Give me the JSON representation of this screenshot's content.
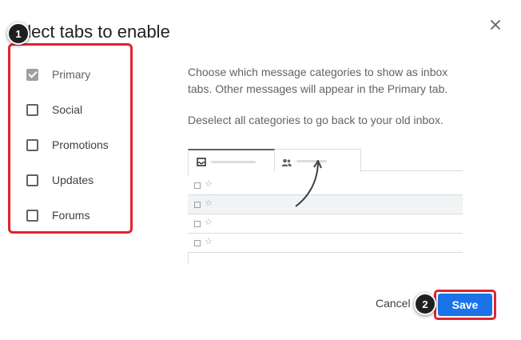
{
  "dialog": {
    "title": "elect tabs to enable",
    "close_icon": "close-icon",
    "categories": [
      {
        "label": "Primary",
        "checked": true,
        "disabled": true
      },
      {
        "label": "Social",
        "checked": false,
        "disabled": false
      },
      {
        "label": "Promotions",
        "checked": false,
        "disabled": false
      },
      {
        "label": "Updates",
        "checked": false,
        "disabled": false
      },
      {
        "label": "Forums",
        "checked": false,
        "disabled": false
      }
    ],
    "description": "Choose which message categories to show as inbox tabs. Other messages will appear in the Primary tab.",
    "description2": "Deselect all categories to go back to your old inbox.",
    "preview": {
      "tab_icons": [
        "inbox-icon",
        "people-icon"
      ],
      "row_star": "☆"
    },
    "cancel_label": "Cancel",
    "save_label": "Save"
  },
  "annotations": {
    "step1": "1",
    "step2": "2"
  },
  "colors": {
    "accent": "#1a73e8",
    "highlight_border": "#e0242f",
    "step_badge": "#1f1f1f"
  }
}
